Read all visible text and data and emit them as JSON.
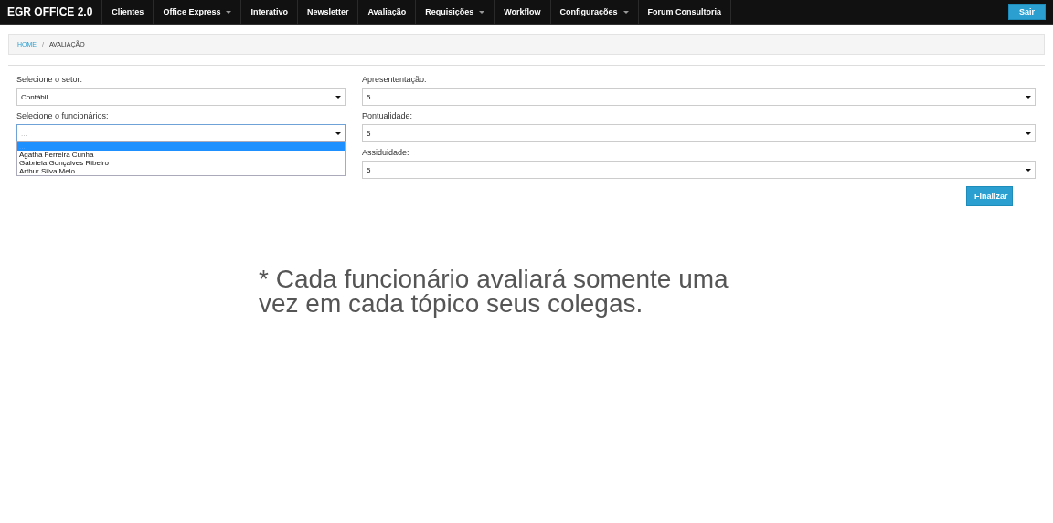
{
  "navbar": {
    "brand": "EGR OFFICE 2.0",
    "items": [
      {
        "label": "Clientes",
        "dropdown": false
      },
      {
        "label": "Office Express",
        "dropdown": true
      },
      {
        "label": "Interativo",
        "dropdown": false
      },
      {
        "label": "Newsletter",
        "dropdown": false
      },
      {
        "label": "Avaliação",
        "dropdown": false
      },
      {
        "label": "Requisições",
        "dropdown": true
      },
      {
        "label": "Workflow",
        "dropdown": false
      },
      {
        "label": "Configurações",
        "dropdown": true
      },
      {
        "label": "Forum Consultoria",
        "dropdown": false
      }
    ],
    "logout": "Sair"
  },
  "breadcrumb": {
    "separator": "/",
    "items": [
      {
        "label": "HOME",
        "link": true
      },
      {
        "label": "AVALIAÇÃO",
        "link": false
      }
    ]
  },
  "left_fields": [
    {
      "label": "Selecione o setor:",
      "value": "Contábil",
      "expanded": false
    },
    {
      "label": "Selecione o funcionários:",
      "placeholder": "...",
      "expanded": true,
      "options": [
        {
          "label": "...",
          "selected": true
        },
        {
          "label": "Agatha Ferreira Cunha",
          "selected": false
        },
        {
          "label": "Gabriela Gonçalves Ribeiro",
          "selected": false
        },
        {
          "label": "Arthur Silva Melo",
          "selected": false
        }
      ]
    }
  ],
  "right_fields": [
    {
      "label": "Apresententação:",
      "value": "5"
    },
    {
      "label": "Pontualidade:",
      "value": "5"
    },
    {
      "label": "Assiduidade:",
      "value": "5"
    }
  ],
  "submit": "Finalizar",
  "note": "* Cada funcionário avaliará somente uma vez em cada tópico seus colegas."
}
